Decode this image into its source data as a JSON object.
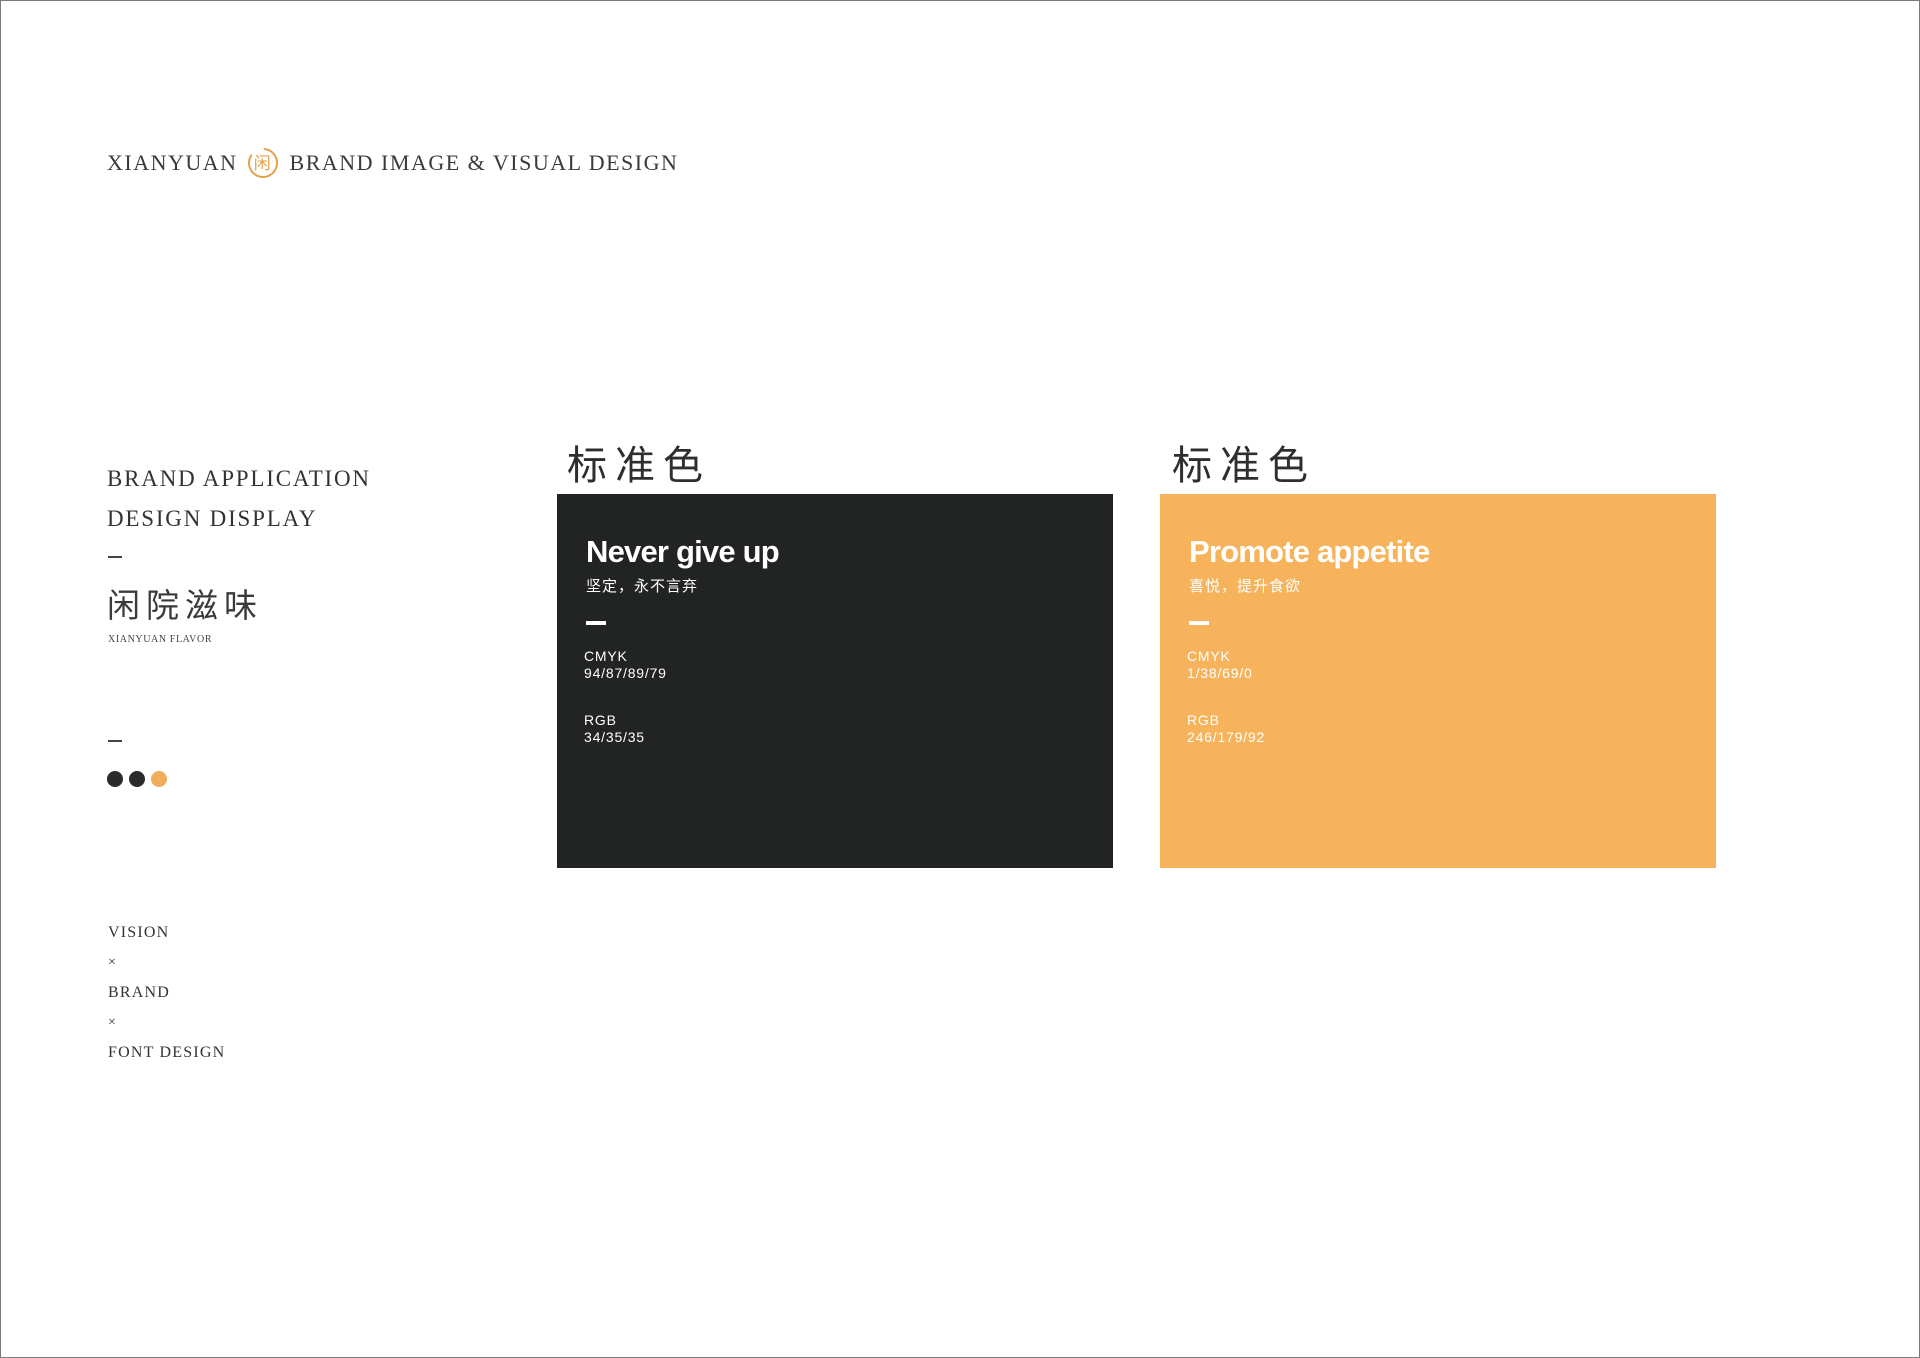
{
  "header": {
    "brand": "XIANYUAN",
    "logo_char": "闲",
    "tagline": "BRAND IMAGE & VISUAL DESIGN",
    "logo_color": "#E3A24B"
  },
  "sidebar": {
    "title_line1": "BRAND APPLICATION",
    "title_line2": "DESIGN DISPLAY",
    "chinese_title": "闲院滋味",
    "english_subtitle": "XIANYUAN FLAVOR",
    "color_dots": [
      "#2b2b2b",
      "#2b2b2b",
      "#F0AE5A"
    ],
    "vision_items": [
      "VISION",
      "×",
      "BRAND",
      "×",
      "FONT DESIGN"
    ]
  },
  "cards": [
    {
      "label": "标准色",
      "title": "Never give up",
      "subtitle": "坚定，永不言弃",
      "cmyk_label": "CMYK",
      "cmyk_value": "94/87/89/79",
      "rgb_label": "RGB",
      "rgb_value": "34/35/35",
      "color": "#222323"
    },
    {
      "label": "标准色",
      "title": "Promote appetite",
      "subtitle": "喜悦，提升食欲",
      "cmyk_label": "CMYK",
      "cmyk_value": "1/38/69/0",
      "rgb_label": "RGB",
      "rgb_value": "246/179/92",
      "color": "#F6B35C"
    }
  ]
}
